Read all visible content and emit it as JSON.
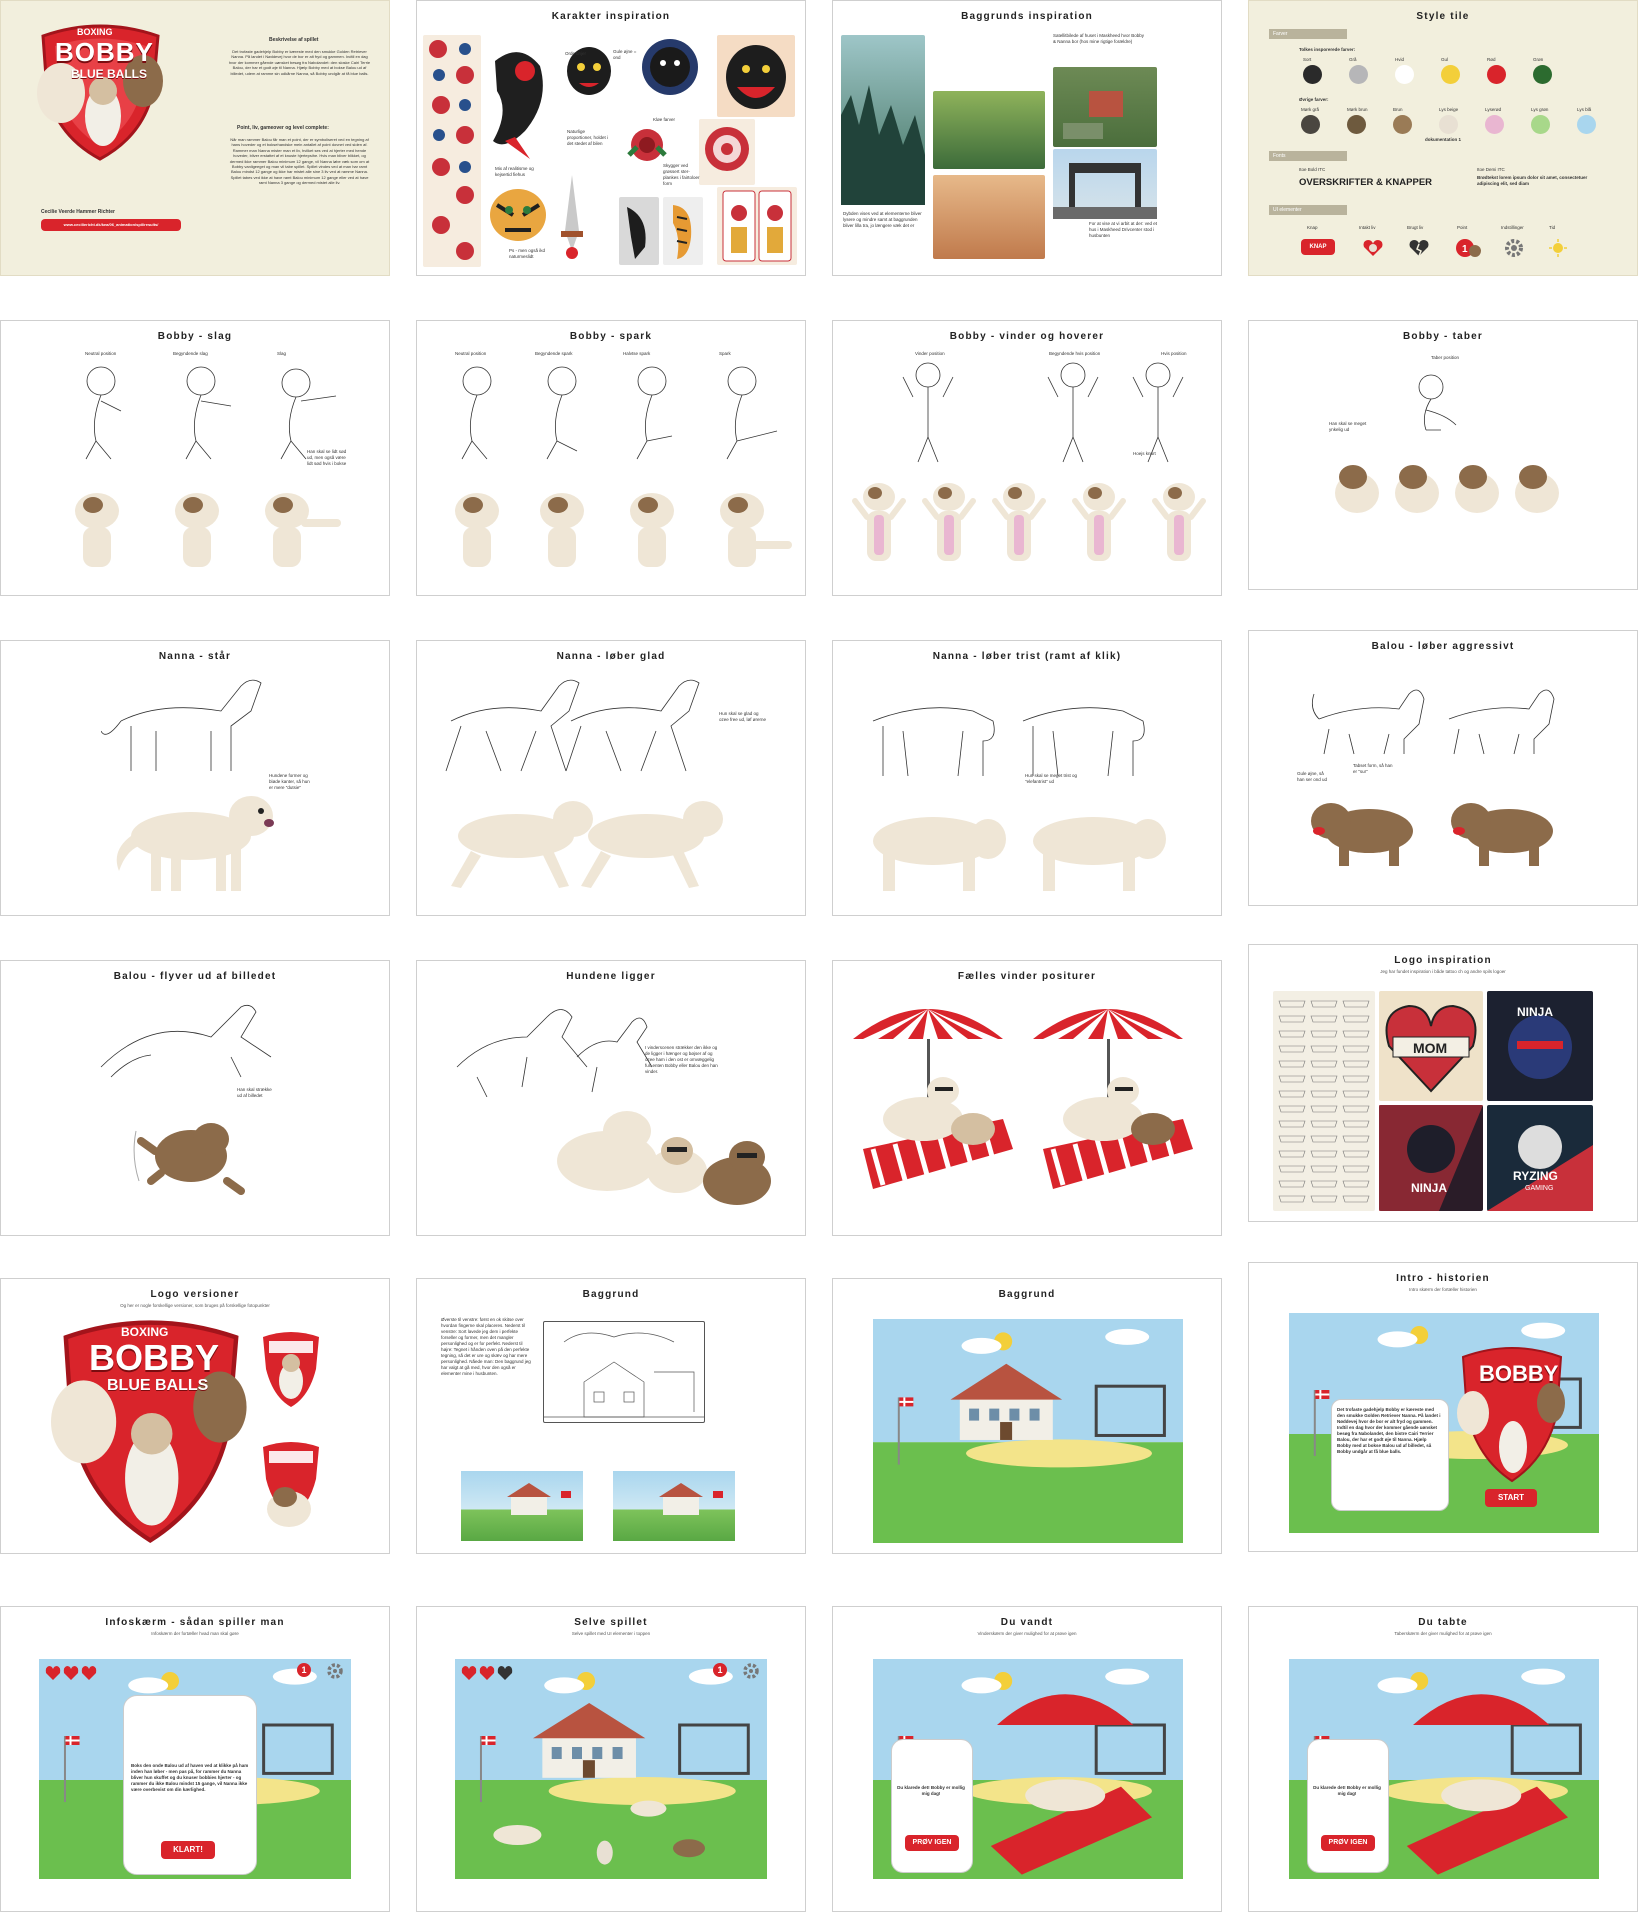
{
  "slides": {
    "s1": {
      "logo": {
        "top": "BOXING",
        "main": "BOBBY",
        "sub": "BLUE BALLS"
      },
      "desc_title": "Beskrivelse af spillet",
      "desc_text": "Det trofaste gadehjelp Bobby er kæreste med den smukke Golden Retriever Nanna. På landet i Nøddevej hvor de bor er alt fryd og gammen. Indtil en dag hvor der kommer gående uønsket besøg fra Nabolandet: den sloske Cairi Terrie Balou, der har et godt øje til Nanna. Hjælp Bobby med at bokse Balou ud af billedet, udem at ramme sin udkårne Nanna, så Bobby undgår at få blue balls.",
      "points_title": "Point, liv, gameover og level complete:",
      "points_text": "Når man rammer Balou får man et point, der er symboliseret ved en tegning af hans hoveder og et boksehandske mein antallet af point dovnet ved siden af. Rammer man Nanna mister man et liv, hvilket ses ved at hjerter med hende hoveder, bliver erstattet af et knuste hjertepsihe. Hvis man bliver blikket, og dermed ikke rammer Balou minimum 12 gange, vil Nanna løbe væk som om at Bobby vanligeeget og man vil tabe spillet. Spillet vindes ved at man har ramt Balou mindst 12 gange og ikke har mistet alle sine 3 liv ved at ramme Nanna. Spillet tabes ved ikke at have ramt Balou minimum 12 gange eller ved at have ramt Nanna 3 gange og dermed mistet alle liv.",
      "author": "Cecilie Veerde Hammer Richter",
      "link": "www.ceciliericht.dk/kea/06_animation/spil/results/"
    },
    "s2": {
      "title": "Karakter inspiration",
      "notes": [
        "Gule øjne = ond",
        "Orde tinjer",
        "Kløe farver",
        "Mix af realitisme og kejsertid fiehus",
        "Skygger ved grøssert ster-plankes i fairtoloer form",
        "Ps - men også ikd naturmeslidt",
        "Naturlige proportioner, holdet i det stedet af bilen",
        "Spiser ikke"
      ]
    },
    "s3": {
      "title": "Baggrunds inspiration",
      "notes": [
        "Satellitbilede af huset i Maskheed hvor Bobby & Nanna bor (hos mine rigtige forældre)",
        "Dybden vises ved at elementerne bliver lysere og mindre samt at baggrunden bliver lilla tra, jo længere væk det er",
        "For at vise at vi arbit at der: ved et hus i Maskheed Drivcenter stod i husbunten"
      ]
    },
    "s4": {
      "title": "Style tile",
      "farver": "Farver",
      "colors_label": "Tolkes insporerede farver:",
      "main_colors": [
        {
          "n": "Sort",
          "c": "#2a2a2a"
        },
        {
          "n": "Grå",
          "c": "#b6b6b8"
        },
        {
          "n": "Hvid",
          "c": "#ffffff"
        },
        {
          "n": "Gul",
          "c": "#f3cf3a"
        },
        {
          "n": "Rød",
          "c": "#d9242b"
        },
        {
          "n": "Grøn",
          "c": "#2c6b2f"
        }
      ],
      "other_label": "Øvrige farver:",
      "other_colors": [
        {
          "n": "Mørk grå",
          "c": "#4a4640"
        },
        {
          "n": "Mørk brun",
          "c": "#6e5a3e"
        },
        {
          "n": "Brun",
          "c": "#9a7b56"
        },
        {
          "n": "Lys beige",
          "c": "#e8e0d3"
        },
        {
          "n": "Lyserød",
          "c": "#e9b6d1"
        },
        {
          "n": "Lys grøn",
          "c": "#a8d88a"
        },
        {
          "n": "Lys blå",
          "c": "#a9d6ee"
        }
      ],
      "doc_note": "dokumentation 1",
      "fonts_label": "Fonts",
      "font1": "Itoe Bold ITC",
      "font2": "Itoe Demi ITC",
      "headline": "OVERSKRIFTER & KNAPPER",
      "body_sample": "Brødtekst lorem ipsum dolor sit amet, consectetuer adipiscing elit, sed diam",
      "ui_label": "UI elementer",
      "ui_items": [
        "Knap",
        "Intakt liv",
        "Brugt liv",
        "Point",
        "Indstillinger",
        "Tid"
      ],
      "knap": "KNAP"
    },
    "s5": {
      "title": "Bobby - slag",
      "labels": [
        "Neutral position",
        "Begyndende slag",
        "Slag"
      ],
      "note": "Han skal se lidt sød ud, men også være lidt sød hvis i bokse"
    },
    "s6": {
      "title": "Bobby - spark",
      "labels": [
        "Neutral position",
        "Begyndende spark",
        "Halvtse spark",
        "Spark"
      ]
    },
    "s7": {
      "title": "Bobby - vinder og hoverer",
      "labels": [
        "Vinder position",
        "Begyndende hvis position",
        "Hvis position"
      ],
      "note": "Hoejs knurt"
    },
    "s8": {
      "title": "Bobby - taber",
      "labels": [
        "Taber position"
      ],
      "note": "Han skal se meget ynkelig ud"
    },
    "s9": {
      "title": "Nanna - står",
      "note": "Hundene former og bløde kanter, så hun er mere \"dutsie\""
    },
    "s10": {
      "title": "Nanna - løber glad",
      "note": "Hun skal se glad og ozee free ud, løf ørerne"
    },
    "s11": {
      "title": "Nanna - løber trist (ramt af klik)",
      "note": "Hun skal se meget trist og \"elefantrist\" ud"
    },
    "s12": {
      "title": "Balou - løber aggressivt",
      "notes": [
        "Gule øjne, så han ser ond ud",
        "Tabset form, så han er \"sur\""
      ]
    },
    "s13": {
      "title": "Balou - flyver ud af billedet",
      "note": "Han skal strække ud af billedet"
    },
    "s14": {
      "title": "Hundene ligger",
      "note": "I vinderscenen strækker den ikke og de ligger i hænger og bøjser af og ozee ham i den ost er omvæggelig fun enten Bobby eller Balou den han vinder."
    },
    "s15": {
      "title": "Fælles vinder positurer"
    },
    "s16": {
      "title": "Logo inspiration",
      "sub": "Jeg har fundet inspiration i både tattoo ch og andre spils logoer",
      "mom": "MOM",
      "ninja": "NINJA",
      "ryzing": "RYZING",
      "gaming": "GAMING"
    },
    "s17": {
      "title": "Logo versioner",
      "sub": "Og her er nogle forskellige versioner, som bruges på forskellige fotopunkter",
      "logo": {
        "top": "BOXING",
        "main": "BOBBY",
        "sub": "BLUE BALLS"
      }
    },
    "s18": {
      "title": "Baggrund",
      "note": "Øverste til venstre: først en ok skitse over hvordan fingerne skal placeres. Nederst til venstre: Sort lavede jeg dem i perfekte forseller og former, men det mangler personlighed og er for perfekt. Nederst til højre: Tegnet i hånden oven på den perfekte tegning, så det er ure og skæv og har mere personlighed. Nåede man: Den baggrund jeg har valgt at gå med, hvor den også er elementer mine i husbunten."
    },
    "s19": {
      "title": "Baggrund"
    },
    "s20": {
      "title": "Intro - historien",
      "sub": "Intro skærm der fortæller historien",
      "story": "Det trofaste gadehjelp Bobby er kæreste med den smukke Golden Retriever Nanna. På landet i Nøddevej hvor de bor er alt fryd og gammen. Indtil en dag hvor der kommer gående uønsket besøg fra Nabolandet, den bistre Cairi Terrier Balou, der har et godt øje til Nanna. Hjælp Bobby med at bokse Balou ud af billedet, så Bobby undgår at få blue balls.",
      "start": "START"
    },
    "s21": {
      "title": "Infoskærm - sådan spiller man",
      "sub": "Infoskærm der fortæller hvad man skal gøre",
      "text": "Boks den onde Balou ud af haven ved at klikke på ham inden han løber - men pas på, for rammer du Nanna bliver hun skuffet og du knuser bobbies hjerter - og rammer du ikke Balou mindst 15 gange, vil Nanna ikke være overbevist om din kærlighed.",
      "btn": "KLART!",
      "score": "1"
    },
    "s22": {
      "title": "Selve spillet",
      "sub": "Selve spillet med UI elementer i toppen",
      "score": "1"
    },
    "s23": {
      "title": "Du vandt",
      "sub": "Vinderskærm der giver mulighed for at prøve igen",
      "text": "Du klarede det! Bobby er mollig mig dag!",
      "btn": "PRØV IGEN"
    },
    "s24": {
      "title": "Du tabte",
      "sub": "Taberskærm der giver mulighed for at prøve igen",
      "text": "Du klarede det! Bobby er mollig mig dag!",
      "btn": "PRØV IGEN"
    }
  }
}
